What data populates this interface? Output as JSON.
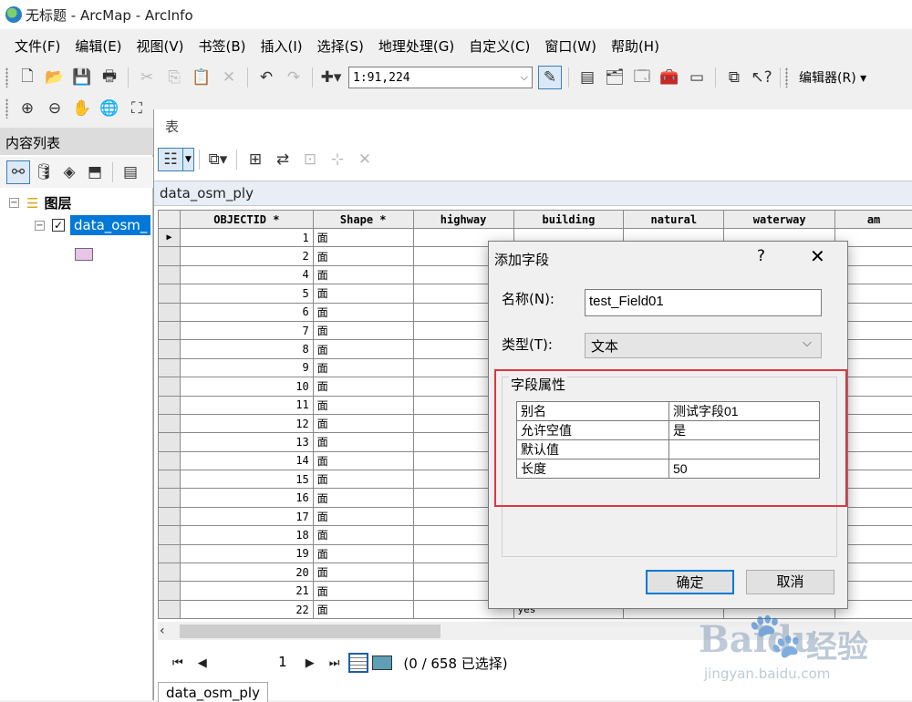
{
  "window": {
    "title": "无标题 - ArcMap - ArcInfo"
  },
  "menu": [
    "文件(F)",
    "编辑(E)",
    "视图(V)",
    "书签(B)",
    "插入(I)",
    "选择(S)",
    "地理处理(G)",
    "自定义(C)",
    "窗口(W)",
    "帮助(H)"
  ],
  "toolbar": {
    "scale": "1:91,224",
    "editor_label": "编辑器(R)",
    "editor_arrow": "▾"
  },
  "toc": {
    "title": "内容列表",
    "layers_label": "图层",
    "layer_name": "data_osm_",
    "layer_checked": true,
    "symbol_color": "#e8c4e8"
  },
  "table_window": {
    "title": "表",
    "table_name": "data_osm_ply",
    "columns": [
      "OBJECTID *",
      "Shape *",
      "highway",
      "building",
      "natural",
      "waterway",
      "am"
    ],
    "rows": [
      {
        "oid": "1",
        "shape": "面"
      },
      {
        "oid": "2",
        "shape": "面"
      },
      {
        "oid": "4",
        "shape": "面"
      },
      {
        "oid": "5",
        "shape": "面"
      },
      {
        "oid": "6",
        "shape": "面"
      },
      {
        "oid": "7",
        "shape": "面"
      },
      {
        "oid": "8",
        "shape": "面"
      },
      {
        "oid": "9",
        "shape": "面"
      },
      {
        "oid": "10",
        "shape": "面"
      },
      {
        "oid": "11",
        "shape": "面"
      },
      {
        "oid": "12",
        "shape": "面"
      },
      {
        "oid": "13",
        "shape": "面"
      },
      {
        "oid": "14",
        "shape": "面"
      },
      {
        "oid": "15",
        "shape": "面"
      },
      {
        "oid": "16",
        "shape": "面"
      },
      {
        "oid": "17",
        "shape": "面"
      },
      {
        "oid": "18",
        "shape": "面"
      },
      {
        "oid": "19",
        "shape": "面"
      },
      {
        "oid": "20",
        "shape": "面"
      },
      {
        "oid": "21",
        "shape": "面"
      },
      {
        "oid": "22",
        "shape": "面"
      }
    ],
    "partial_building_value": "yes",
    "current_row_marker": "▶",
    "current_record": "1",
    "selection_status": "(0 / 658 已选择)",
    "bottom_tab": "data_osm_ply"
  },
  "dialog": {
    "title": "添加字段",
    "help": "?",
    "close": "✕",
    "name_label": "名称(N):",
    "name_value": "test_Field01",
    "type_label": "类型(T):",
    "type_value": "文本",
    "group_title": "字段属性",
    "properties": [
      {
        "key": "别名",
        "value": "测试字段01"
      },
      {
        "key": "允许空值",
        "value": "是"
      },
      {
        "key": "默认值",
        "value": ""
      },
      {
        "key": "长度",
        "value": "50"
      }
    ],
    "ok": "确定",
    "cancel": "取消",
    "highlight_color": "#e0353d"
  },
  "watermark": {
    "brand": "Baidu",
    "paw": "🐾",
    "product": "经验",
    "url": "jingyan.baidu.com"
  }
}
